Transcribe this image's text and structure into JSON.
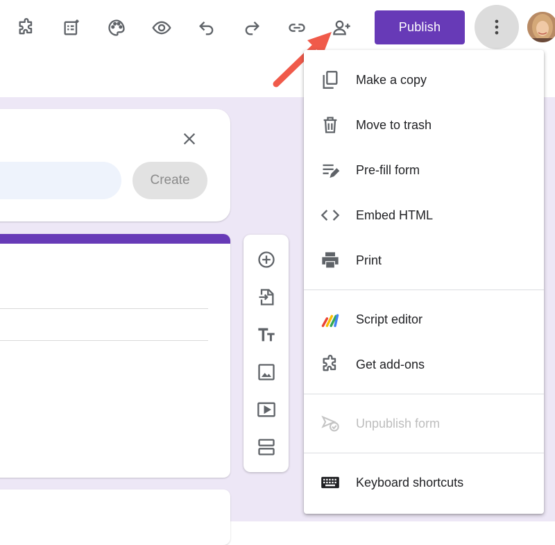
{
  "toolbar": {
    "icons": [
      "addons-icon",
      "customize-icon",
      "palette-icon",
      "preview-eye-icon",
      "undo-icon",
      "redo-icon",
      "link-icon",
      "add-collaborator-icon"
    ],
    "publish_label": "Publish",
    "more_icon": "more-vert-icon"
  },
  "share_card": {
    "create_label": "Create"
  },
  "side_tools": [
    "add-question-icon",
    "import-questions-icon",
    "title-text-icon",
    "image-icon",
    "video-icon",
    "section-icon"
  ],
  "menu": {
    "items": [
      {
        "label": "Make a copy",
        "icon": "copy-icon"
      },
      {
        "label": "Move to trash",
        "icon": "trash-icon"
      },
      {
        "label": "Pre-fill form",
        "icon": "prefill-icon"
      },
      {
        "label": "Embed HTML",
        "icon": "embed-code-icon"
      },
      {
        "label": "Print",
        "icon": "print-icon"
      },
      {
        "label": "Script editor",
        "icon": "apps-script-icon"
      },
      {
        "label": "Get add-ons",
        "icon": "addons-icon"
      },
      {
        "label": "Unpublish form",
        "icon": "unpublish-icon",
        "disabled": true
      },
      {
        "label": "Keyboard shortcuts",
        "icon": "keyboard-icon"
      }
    ]
  },
  "colors": {
    "accent": "#673ab7",
    "canvas_bg": "#ede7f6",
    "annotation_arrow": "#f05a4a"
  }
}
